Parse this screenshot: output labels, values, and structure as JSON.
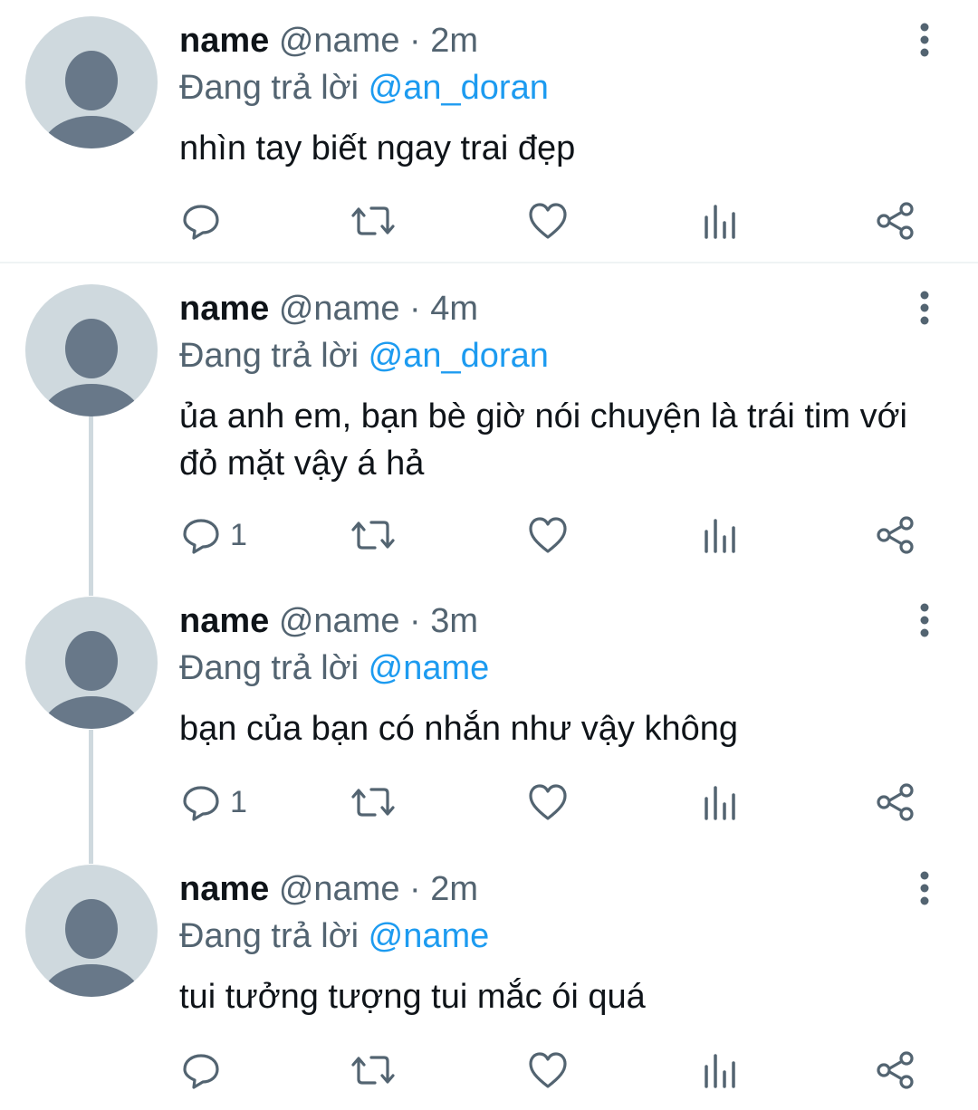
{
  "tweets": [
    {
      "display_name": "name",
      "handle": "@name",
      "separator": "·",
      "time": "2m",
      "reply_prefix": "Đang trả lời",
      "reply_to": "@an_doran",
      "text": "nhìn tay biết ngay trai đẹp",
      "reply_count": ""
    },
    {
      "display_name": "name",
      "handle": "@name",
      "separator": "·",
      "time": "4m",
      "reply_prefix": "Đang trả lời",
      "reply_to": "@an_doran",
      "text": "ủa anh em, bạn bè giờ nói chuyện là trái tim với đỏ mặt vậy á hả",
      "reply_count": "1"
    },
    {
      "display_name": "name",
      "handle": "@name",
      "separator": "·",
      "time": "3m",
      "reply_prefix": "Đang trả lời",
      "reply_to": "@name",
      "text": "bạn của bạn có nhắn như vậy không",
      "reply_count": "1"
    },
    {
      "display_name": "name",
      "handle": "@name",
      "separator": "·",
      "time": "2m",
      "reply_prefix": "Đang trả lời",
      "reply_to": "@name",
      "text": "tui tưởng tượng tui mắc ói quá",
      "reply_count": ""
    }
  ],
  "icons": {
    "reply": "reply-icon",
    "retweet": "retweet-icon",
    "like": "heart-icon",
    "views": "views-icon",
    "share": "share-icon",
    "more": "more-vertical-icon"
  },
  "colors": {
    "text": "#0f1419",
    "secondary": "#536471",
    "mention": "#1d9bf0",
    "avatar_bg": "#cfd9de",
    "avatar_fg": "#687889"
  }
}
